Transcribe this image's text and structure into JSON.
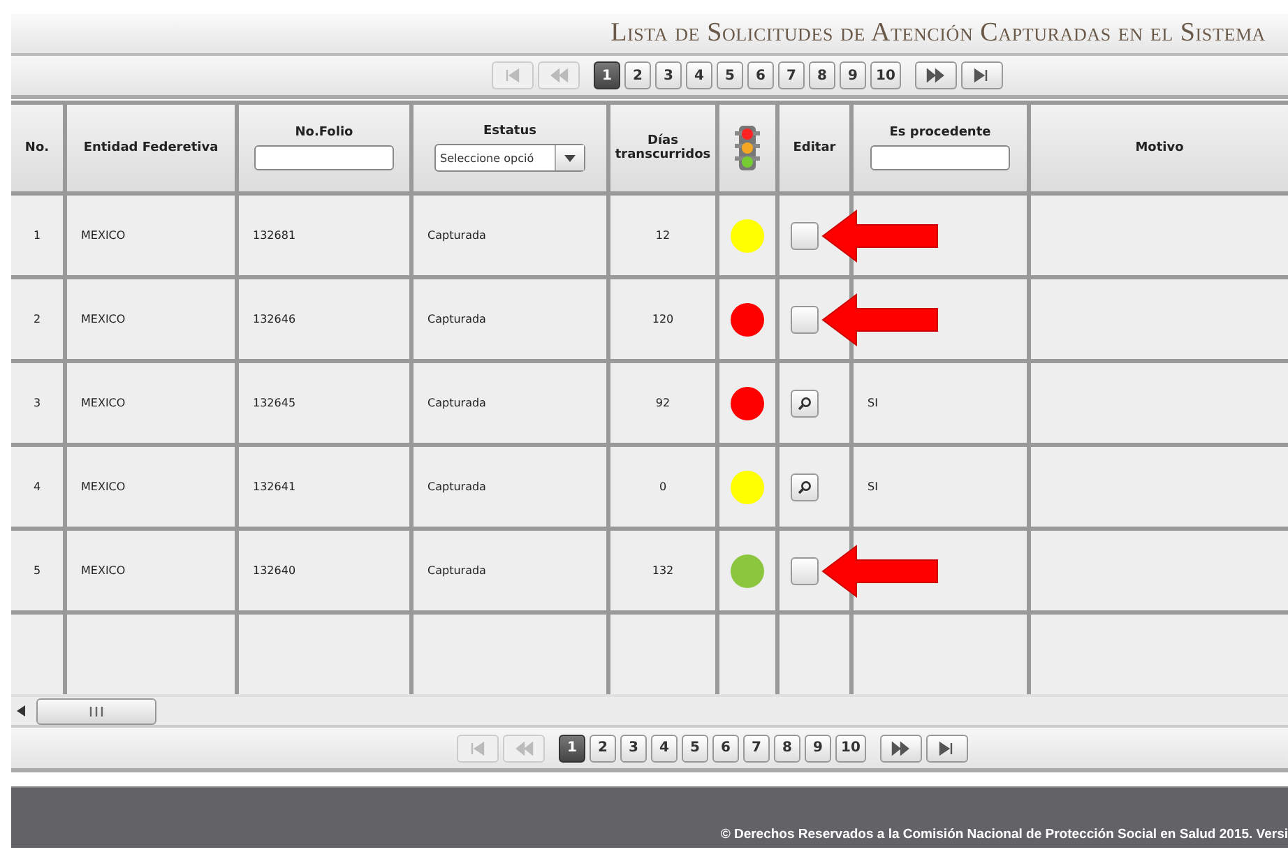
{
  "title": "Lista de Solicitudes de Atención Capturadas en el Sistema",
  "pager_top": {
    "nav_start": [
      {
        "kind": "first",
        "disabled": true
      },
      {
        "kind": "prev",
        "disabled": true
      }
    ],
    "pages": [
      {
        "label": "1",
        "selected": true
      },
      {
        "label": "2",
        "selected": false
      },
      {
        "label": "3",
        "selected": false
      },
      {
        "label": "4",
        "selected": false
      },
      {
        "label": "5",
        "selected": false
      },
      {
        "label": "6",
        "selected": false
      },
      {
        "label": "7",
        "selected": false
      },
      {
        "label": "8",
        "selected": false
      },
      {
        "label": "9",
        "selected": false
      },
      {
        "label": "10",
        "selected": false
      }
    ],
    "nav_end": [
      {
        "kind": "next",
        "disabled": false
      },
      {
        "kind": "last",
        "disabled": false
      }
    ]
  },
  "columns": [
    {
      "kind": "text",
      "label": "No."
    },
    {
      "kind": "text",
      "label": "Entidad Federetiva"
    },
    {
      "kind": "input",
      "label": "No.Folio"
    },
    {
      "kind": "select",
      "label": "Estatus",
      "placeholder": "Seleccione opció"
    },
    {
      "kind": "text",
      "label": "Días transcurridos"
    },
    {
      "kind": "semaphore"
    },
    {
      "kind": "text",
      "label": "Editar"
    },
    {
      "kind": "input",
      "label": "Es procedente"
    },
    {
      "kind": "text",
      "label": "Motivo"
    }
  ],
  "rows": [
    {
      "no": "1",
      "entidad": "MEXICO",
      "folio": "132681",
      "estatus": "Capturada",
      "dias": "12",
      "color": "#ffff00",
      "procedente": "",
      "arrow": true
    },
    {
      "no": "2",
      "entidad": "MEXICO",
      "folio": "132646",
      "estatus": "Capturada",
      "dias": "120",
      "color": "#ff0000",
      "procedente": "",
      "arrow": true
    },
    {
      "no": "3",
      "entidad": "MEXICO",
      "folio": "132645",
      "estatus": "Capturada",
      "dias": "92",
      "color": "#ff0000",
      "procedente": "SI",
      "arrow": false
    },
    {
      "no": "4",
      "entidad": "MEXICO",
      "folio": "132641",
      "estatus": "Capturada",
      "dias": "0",
      "color": "#ffff00",
      "procedente": "SI",
      "arrow": false
    },
    {
      "no": "5",
      "entidad": "MEXICO",
      "folio": "132640",
      "estatus": "Capturada",
      "dias": "132",
      "color": "#8cc63f",
      "procedente": "",
      "arrow": true
    }
  ],
  "pager_bottom": {
    "nav_start": [
      {
        "kind": "first",
        "disabled": true
      },
      {
        "kind": "prev",
        "disabled": true
      }
    ],
    "pages": [
      {
        "label": "1",
        "selected": true
      },
      {
        "label": "2",
        "selected": false
      },
      {
        "label": "3",
        "selected": false
      },
      {
        "label": "4",
        "selected": false
      },
      {
        "label": "5",
        "selected": false
      },
      {
        "label": "6",
        "selected": false
      },
      {
        "label": "7",
        "selected": false
      },
      {
        "label": "8",
        "selected": false
      },
      {
        "label": "9",
        "selected": false
      },
      {
        "label": "10",
        "selected": false
      }
    ],
    "nav_end": [
      {
        "kind": "next",
        "disabled": false
      },
      {
        "kind": "last",
        "disabled": false
      }
    ]
  },
  "footer": "© Derechos Reservados a la Comisión Nacional de Protección Social en Salud 2015. Versi"
}
